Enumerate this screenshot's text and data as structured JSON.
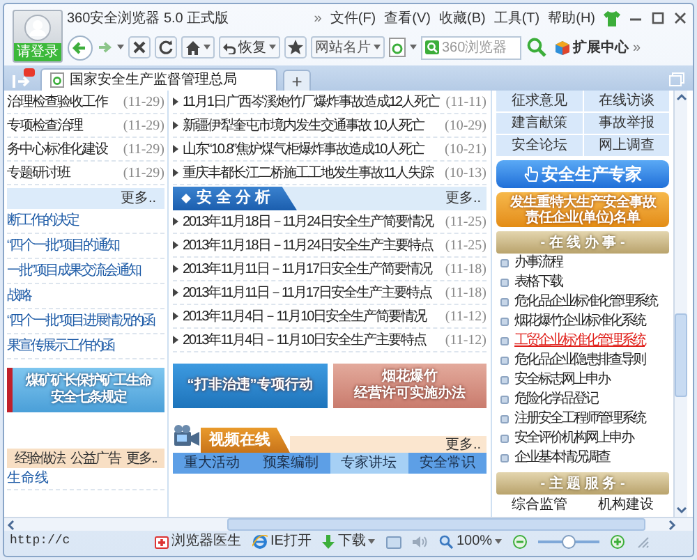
{
  "browser": {
    "title": "360安全浏览器 5.0 正式版",
    "login": "请登录",
    "menu_more": "»",
    "menu": [
      "文件(F)",
      "查看(V)",
      "收藏(B)",
      "工具(T)",
      "帮助(H)"
    ]
  },
  "toolbar": {
    "restore": "恢复",
    "site_card": "网站名片",
    "search": {
      "placeholder": "360浏览器"
    },
    "extensions": "扩展中心",
    "more": "»"
  },
  "tabs": [
    {
      "label": "国家安全生产监督管理总局",
      "selected": true
    }
  ],
  "new_tab": "+",
  "left_column": {
    "news": [
      {
        "title": "治理检查验收工作",
        "date": "(11-29)"
      },
      {
        "title": "专项检查治理",
        "date": "(11-29)"
      },
      {
        "title": "务中心标准化建设",
        "date": "(11-29)"
      },
      {
        "title": "专题研讨班",
        "date": "(11-29)"
      }
    ],
    "more": "更多..",
    "links": [
      "断工作的决定",
      "“四个一批”项目的通知",
      "一批”项目成果交流会通知",
      "战略",
      "“四个一批”项目进展情况的函",
      "果宣传展示工作的函"
    ],
    "banner": [
      "煤矿矿长保护矿工生命",
      "安全七条规定"
    ],
    "bottom_bar": [
      "经验做法",
      "公益广告",
      "更多.."
    ],
    "bottom_link": "生命线"
  },
  "middle_column": {
    "news": [
      {
        "title": "11月1日广西岑溪炮竹厂爆炸事故造成12人死亡",
        "date": "(11-11)"
      },
      {
        "title": "新疆伊犁奎屯市境内发生交通事故 10人死亡",
        "date": "(10-29)"
      },
      {
        "title": "山东“10.8”焦炉煤气柜爆炸事故造成10人死亡",
        "date": "(10-21)"
      },
      {
        "title": "重庆丰都长江二桥施工工地发生事故11人失踪",
        "date": "(10-13)"
      }
    ],
    "analysis": {
      "title": "安全分析",
      "more": "更多..",
      "items": [
        {
          "title": "2013年11月18日－11月24日安全生产简要情况",
          "date": "(11-25)"
        },
        {
          "title": "2013年11月18日－11月24日安全生产主要特点",
          "date": "(11-25)"
        },
        {
          "title": "2013年11月11日－11月17日安全生产简要情况",
          "date": "(11-18)"
        },
        {
          "title": "2013年11月11日－11月17日安全生产主要特点",
          "date": "(11-18)"
        },
        {
          "title": "2013年11月4日－11月10日安全生产简要情况",
          "date": "(11-12)"
        },
        {
          "title": "2013年11月4日－11月10日安全生产主要特点",
          "date": "(11-12)"
        }
      ]
    },
    "banners": [
      {
        "kind": "blue",
        "lines": [
          "“打非治违”专项行动"
        ]
      },
      {
        "kind": "rose",
        "lines": [
          "烟花爆竹",
          "经营许可实施办法"
        ]
      }
    ],
    "video": {
      "title": "视频在线",
      "more": "更多..",
      "tabs": [
        {
          "label": "重大活动",
          "selected": false
        },
        {
          "label": "预案编制",
          "selected": false
        },
        {
          "label": "专家讲坛",
          "selected": true
        },
        {
          "label": "安全常识",
          "selected": false
        }
      ]
    }
  },
  "right_column": {
    "links": [
      "征求意见",
      "在线访谈",
      "建言献策",
      "事故举报",
      "安全论坛",
      "网上调查"
    ],
    "expert_button": "安全生产专家",
    "banner": [
      "发生重特大生产安全事故",
      "责任企业(单位)名单"
    ],
    "online_services": {
      "title": "- 在 线 办 事 -",
      "items": [
        {
          "label": "办事流程",
          "hovered": false
        },
        {
          "label": "表格下载",
          "hovered": false
        },
        {
          "label": "危化品企业标准化管理系统",
          "hovered": false
        },
        {
          "label": "烟花爆竹企业标准化系统",
          "hovered": false
        },
        {
          "label": "工贸企业标准化管理系统",
          "hovered": true
        },
        {
          "label": "危化品企业隐患排查导则",
          "hovered": false
        },
        {
          "label": "安全标志网上申办",
          "hovered": false
        },
        {
          "label": "危险化学品登记",
          "hovered": false
        },
        {
          "label": "注册安全工程师管理系统",
          "hovered": false
        },
        {
          "label": "安全评价机构网上申办",
          "hovered": false
        },
        {
          "label": "企业基本情况调查",
          "hovered": false
        }
      ]
    },
    "theme_services": {
      "title": "- 主 题 服 务 -",
      "items": [
        "综合监管",
        "机构建设"
      ]
    }
  },
  "status_bar": {
    "url": "http://c",
    "doctor": "浏览器医生",
    "ie_open": "IE打开",
    "download": "下载",
    "zoom": "100%",
    "zoom_slider": {
      "level": 0.5
    }
  }
}
